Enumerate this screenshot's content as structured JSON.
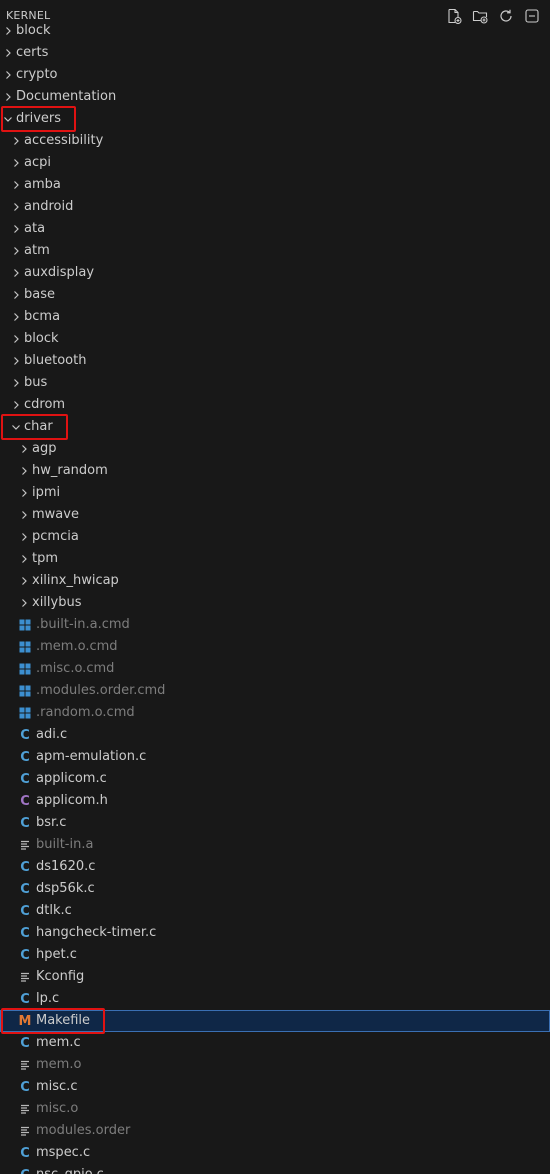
{
  "header": {
    "title": "KERNEL"
  },
  "actions": [
    {
      "name": "new-file-icon"
    },
    {
      "name": "new-folder-icon"
    },
    {
      "name": "refresh-icon"
    },
    {
      "name": "collapse-all-icon"
    }
  ],
  "colors": {
    "background": "#181818",
    "selection": "#0f2747",
    "selection_border": "#3a6fb3",
    "c_icon": "#4fa0d6",
    "h_icon": "#a074c4",
    "makefile_icon": "#e37933",
    "highlight_box": "#e01212"
  },
  "tree": [
    {
      "label": "block",
      "type": "folder",
      "expanded": false,
      "depth": 0,
      "partial": true
    },
    {
      "label": "certs",
      "type": "folder",
      "expanded": false,
      "depth": 0
    },
    {
      "label": "crypto",
      "type": "folder",
      "expanded": false,
      "depth": 0
    },
    {
      "label": "Documentation",
      "type": "folder",
      "expanded": false,
      "depth": 0
    },
    {
      "label": "drivers",
      "type": "folder",
      "expanded": true,
      "depth": 0,
      "highlight": true
    },
    {
      "label": "accessibility",
      "type": "folder",
      "expanded": false,
      "depth": 1
    },
    {
      "label": "acpi",
      "type": "folder",
      "expanded": false,
      "depth": 1
    },
    {
      "label": "amba",
      "type": "folder",
      "expanded": false,
      "depth": 1
    },
    {
      "label": "android",
      "type": "folder",
      "expanded": false,
      "depth": 1
    },
    {
      "label": "ata",
      "type": "folder",
      "expanded": false,
      "depth": 1
    },
    {
      "label": "atm",
      "type": "folder",
      "expanded": false,
      "depth": 1
    },
    {
      "label": "auxdisplay",
      "type": "folder",
      "expanded": false,
      "depth": 1
    },
    {
      "label": "base",
      "type": "folder",
      "expanded": false,
      "depth": 1
    },
    {
      "label": "bcma",
      "type": "folder",
      "expanded": false,
      "depth": 1
    },
    {
      "label": "block",
      "type": "folder",
      "expanded": false,
      "depth": 1
    },
    {
      "label": "bluetooth",
      "type": "folder",
      "expanded": false,
      "depth": 1
    },
    {
      "label": "bus",
      "type": "folder",
      "expanded": false,
      "depth": 1
    },
    {
      "label": "cdrom",
      "type": "folder",
      "expanded": false,
      "depth": 1
    },
    {
      "label": "char",
      "type": "folder",
      "expanded": true,
      "depth": 1,
      "highlight": true
    },
    {
      "label": "agp",
      "type": "folder",
      "expanded": false,
      "depth": 2
    },
    {
      "label": "hw_random",
      "type": "folder",
      "expanded": false,
      "depth": 2
    },
    {
      "label": "ipmi",
      "type": "folder",
      "expanded": false,
      "depth": 2
    },
    {
      "label": "mwave",
      "type": "folder",
      "expanded": false,
      "depth": 2
    },
    {
      "label": "pcmcia",
      "type": "folder",
      "expanded": false,
      "depth": 2
    },
    {
      "label": "tpm",
      "type": "folder",
      "expanded": false,
      "depth": 2
    },
    {
      "label": "xilinx_hwicap",
      "type": "folder",
      "expanded": false,
      "depth": 2
    },
    {
      "label": "xillybus",
      "type": "folder",
      "expanded": false,
      "depth": 2
    },
    {
      "label": ".built-in.a.cmd",
      "type": "cmd",
      "depth": 2,
      "dim": true
    },
    {
      "label": ".mem.o.cmd",
      "type": "cmd",
      "depth": 2,
      "dim": true
    },
    {
      "label": ".misc.o.cmd",
      "type": "cmd",
      "depth": 2,
      "dim": true
    },
    {
      "label": ".modules.order.cmd",
      "type": "cmd",
      "depth": 2,
      "dim": true
    },
    {
      "label": ".random.o.cmd",
      "type": "cmd",
      "depth": 2,
      "dim": true
    },
    {
      "label": "adi.c",
      "type": "c",
      "depth": 2
    },
    {
      "label": "apm-emulation.c",
      "type": "c",
      "depth": 2
    },
    {
      "label": "applicom.c",
      "type": "c",
      "depth": 2
    },
    {
      "label": "applicom.h",
      "type": "h",
      "depth": 2
    },
    {
      "label": "bsr.c",
      "type": "c",
      "depth": 2
    },
    {
      "label": "built-in.a",
      "type": "text",
      "depth": 2,
      "dim": true
    },
    {
      "label": "ds1620.c",
      "type": "c",
      "depth": 2
    },
    {
      "label": "dsp56k.c",
      "type": "c",
      "depth": 2
    },
    {
      "label": "dtlk.c",
      "type": "c",
      "depth": 2
    },
    {
      "label": "hangcheck-timer.c",
      "type": "c",
      "depth": 2
    },
    {
      "label": "hpet.c",
      "type": "c",
      "depth": 2
    },
    {
      "label": "Kconfig",
      "type": "text",
      "depth": 2
    },
    {
      "label": "lp.c",
      "type": "c",
      "depth": 2
    },
    {
      "label": "Makefile",
      "type": "makefile",
      "depth": 2,
      "selected": true,
      "highlight": true
    },
    {
      "label": "mem.c",
      "type": "c",
      "depth": 2
    },
    {
      "label": "mem.o",
      "type": "text",
      "depth": 2,
      "dim": true
    },
    {
      "label": "misc.c",
      "type": "c",
      "depth": 2
    },
    {
      "label": "misc.o",
      "type": "text",
      "depth": 2,
      "dim": true
    },
    {
      "label": "modules.order",
      "type": "text",
      "depth": 2,
      "dim": true
    },
    {
      "label": "mspec.c",
      "type": "c",
      "depth": 2
    },
    {
      "label": "nsc_gpio.c",
      "type": "c",
      "depth": 2,
      "partial": true
    }
  ]
}
